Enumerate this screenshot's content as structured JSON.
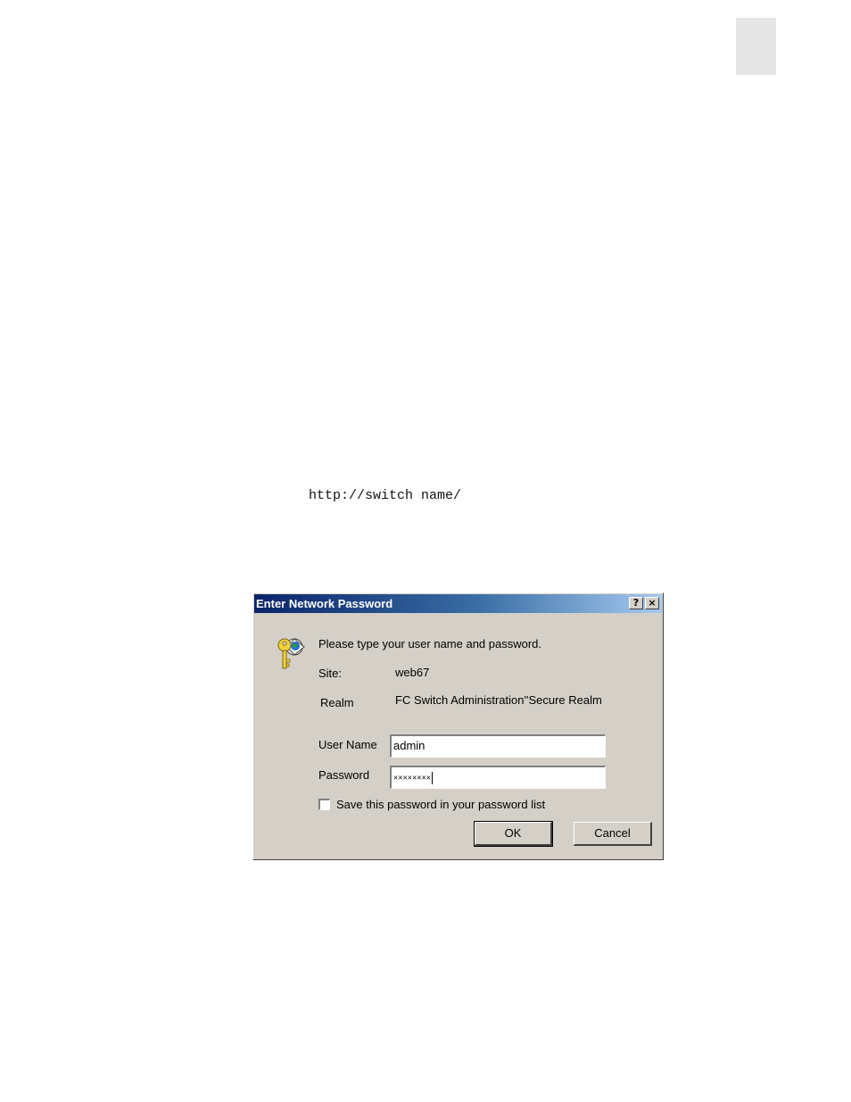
{
  "document": {
    "url_example": "http://switch name/"
  },
  "dialog": {
    "title": "Enter Network Password",
    "help_glyph": "?",
    "close_glyph": "×",
    "prompt": "Please type your user name and password.",
    "site_label": "Site:",
    "site_value": "web67",
    "realm_label": "Realm",
    "realm_value": "FC Switch Administration''Secure Realm",
    "username_label": "User Name",
    "username_value": "admin",
    "password_label": "Password",
    "password_value": "××××××××",
    "save_password_label": "Save this password in your password list",
    "save_password_checked": false,
    "ok_label": "OK",
    "cancel_label": "Cancel",
    "icon": "key-globe-icon"
  },
  "colors": {
    "titlebar_start": "#0a246a",
    "titlebar_end": "#a6caf0",
    "dialog_face": "#d4d0c8",
    "thumb_tab": "#e6e6e6"
  }
}
